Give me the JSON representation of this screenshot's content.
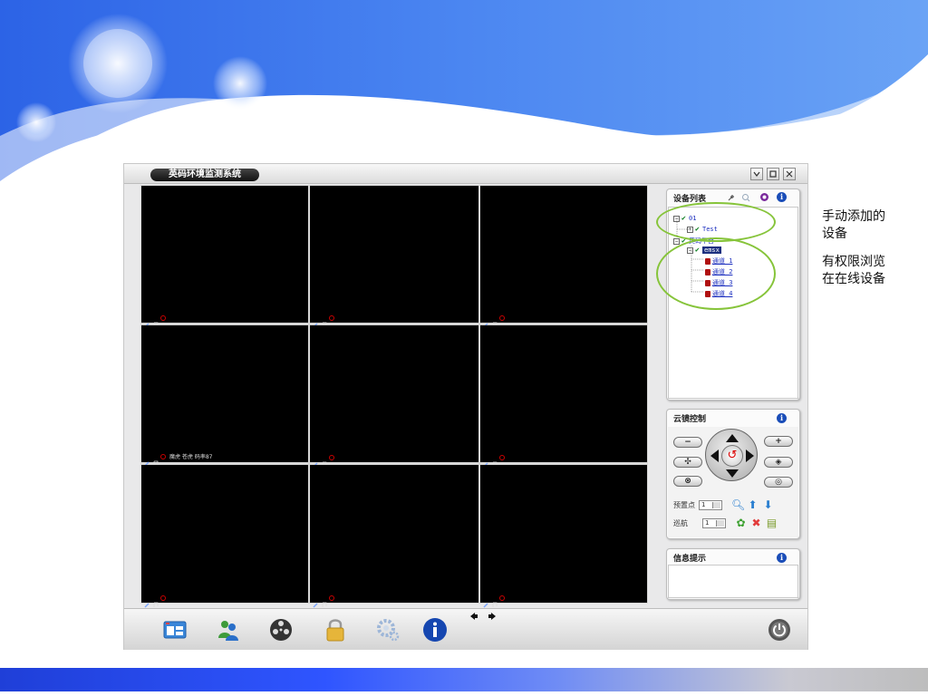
{
  "app": {
    "title": "英码环境监测系统"
  },
  "grid": {
    "overlay_text": "魔虎  苍虎     码率87"
  },
  "device_list": {
    "title": "设备列表",
    "tree": [
      {
        "label": "01",
        "level": 0
      },
      {
        "label": "Test",
        "level": 1
      },
      {
        "label": "英码平台",
        "level": 0
      },
      {
        "label": "emsx",
        "level": 1
      },
      {
        "label": "通道 1",
        "level": 2
      },
      {
        "label": "通道 2",
        "level": 2
      },
      {
        "label": "通道 3",
        "level": 2
      },
      {
        "label": "通道 4",
        "level": 2
      }
    ]
  },
  "ptz": {
    "title": "云镜控制",
    "preset_label": "预置点",
    "preset_value": "1",
    "cruise_label": "巡航",
    "cruise_value": "1",
    "zoom_out": "−",
    "zoom_in": "+",
    "focus_near": "✣",
    "focus_far": "◈",
    "iris_close": "⊗",
    "iris_open": "◎"
  },
  "info": {
    "title": "信息提示"
  },
  "annotations": {
    "manual_add": "手动添加的设备",
    "authorized": "有权限浏览在在线设备"
  },
  "colors": {
    "accent_blue": "#1a4db8",
    "annotation_green": "#86c43a",
    "tree_text": "#1c2fbf"
  }
}
